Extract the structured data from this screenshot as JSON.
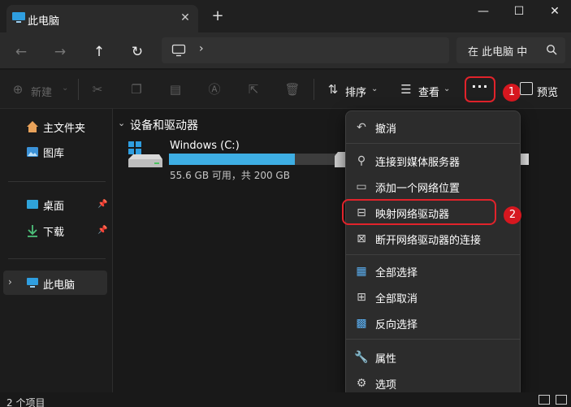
{
  "window": {
    "tab_title": "此电脑",
    "new_tab": "+",
    "close_tab": "✕"
  },
  "nav": {
    "search_placeholder": "在 此电脑 中"
  },
  "toolbar": {
    "new_label": "新建",
    "sort_label": "排序",
    "view_label": "查看",
    "more_label": "···",
    "preview_label": "预览",
    "badge1": "1",
    "badge2": "2"
  },
  "sidebar": {
    "items": [
      {
        "label": "主文件夹"
      },
      {
        "label": "图库"
      },
      {
        "label": "桌面"
      },
      {
        "label": "下载"
      },
      {
        "label": "此电脑"
      }
    ]
  },
  "main": {
    "section_title": "设备和驱动器",
    "drives": [
      {
        "name": "Windows (C:)",
        "info": "55.6 GB 可用，共 200 GB",
        "used_fraction": 0.722
      }
    ]
  },
  "menu": {
    "items": [
      {
        "label": "撤消",
        "icon": "undo-icon"
      },
      {
        "label": "连接到媒体服务器",
        "icon": "media-server-icon"
      },
      {
        "label": "添加一个网络位置",
        "icon": "network-location-icon"
      },
      {
        "label": "映射网络驱动器",
        "icon": "map-drive-icon"
      },
      {
        "label": "断开网络驱动器的连接",
        "icon": "disconnect-drive-icon"
      },
      {
        "label": "全部选择",
        "icon": "select-all-icon"
      },
      {
        "label": "全部取消",
        "icon": "select-none-icon"
      },
      {
        "label": "反向选择",
        "icon": "invert-selection-icon"
      },
      {
        "label": "属性",
        "icon": "properties-icon"
      },
      {
        "label": "选项",
        "icon": "options-icon"
      }
    ]
  },
  "status": {
    "text": "2 个项目"
  },
  "colors": {
    "accent": "#3eaee3",
    "highlight": "#e1232b",
    "menu_bg": "#2c2c2c"
  }
}
